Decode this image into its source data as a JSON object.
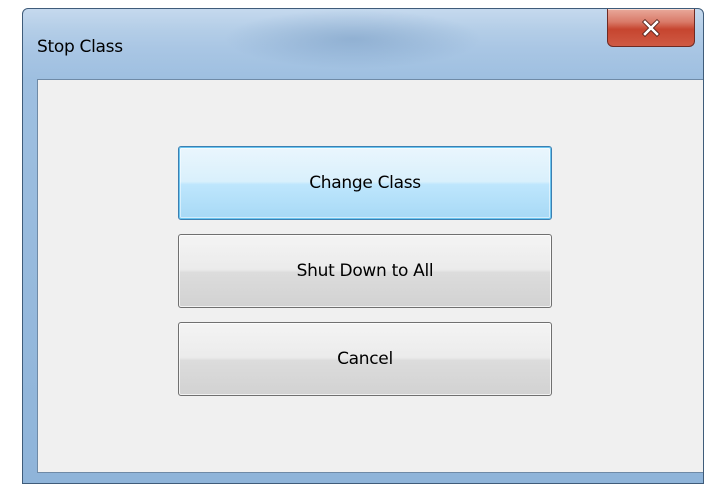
{
  "window": {
    "title": "Stop Class",
    "close_icon": "close-icon"
  },
  "buttons": {
    "change_class": "Change Class",
    "shut_down_all": "Shut Down to All",
    "cancel": "Cancel"
  },
  "colors": {
    "close_button": "#c6452f",
    "focused_button_border": "#3c7fb1",
    "client_background": "#f0f0f0"
  }
}
